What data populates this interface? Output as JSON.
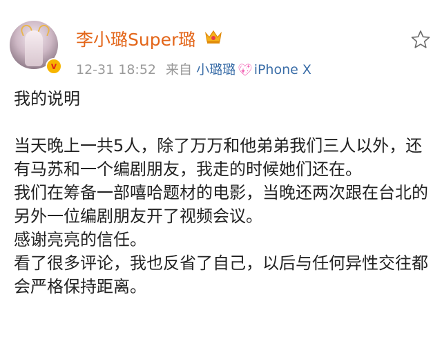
{
  "post": {
    "username": "李小璐Super璐",
    "timestamp": "12-31 18:52",
    "source_prefix": "来自",
    "source_name": "小璐璐",
    "device": "iPhone X",
    "verified_mark": "v",
    "heading": "我的说明",
    "paragraphs": [
      "当天晚上一共5人，除了万万和他弟弟我们三人以外，还有马苏和一个编剧朋友，我走的时候她们还在。",
      "我们在筹备一部嘻哈题材的电影，当晚还两次跟在台北的另外一位编剧朋友开了视频会议。",
      "感谢亮亮的信任。",
      "看了很多评论，我也反省了自己，以后与任何异性交往都会严格保持距离。"
    ]
  },
  "icons": {
    "crown": "crown-icon",
    "favorite": "star-outline-icon",
    "heart": "sparkle-heart-icon"
  },
  "colors": {
    "username": "#e3661a",
    "link": "#3b6ea8",
    "meta": "#9a9a9a",
    "heart": "#f260b4",
    "verified_badge": "#f7b500"
  }
}
